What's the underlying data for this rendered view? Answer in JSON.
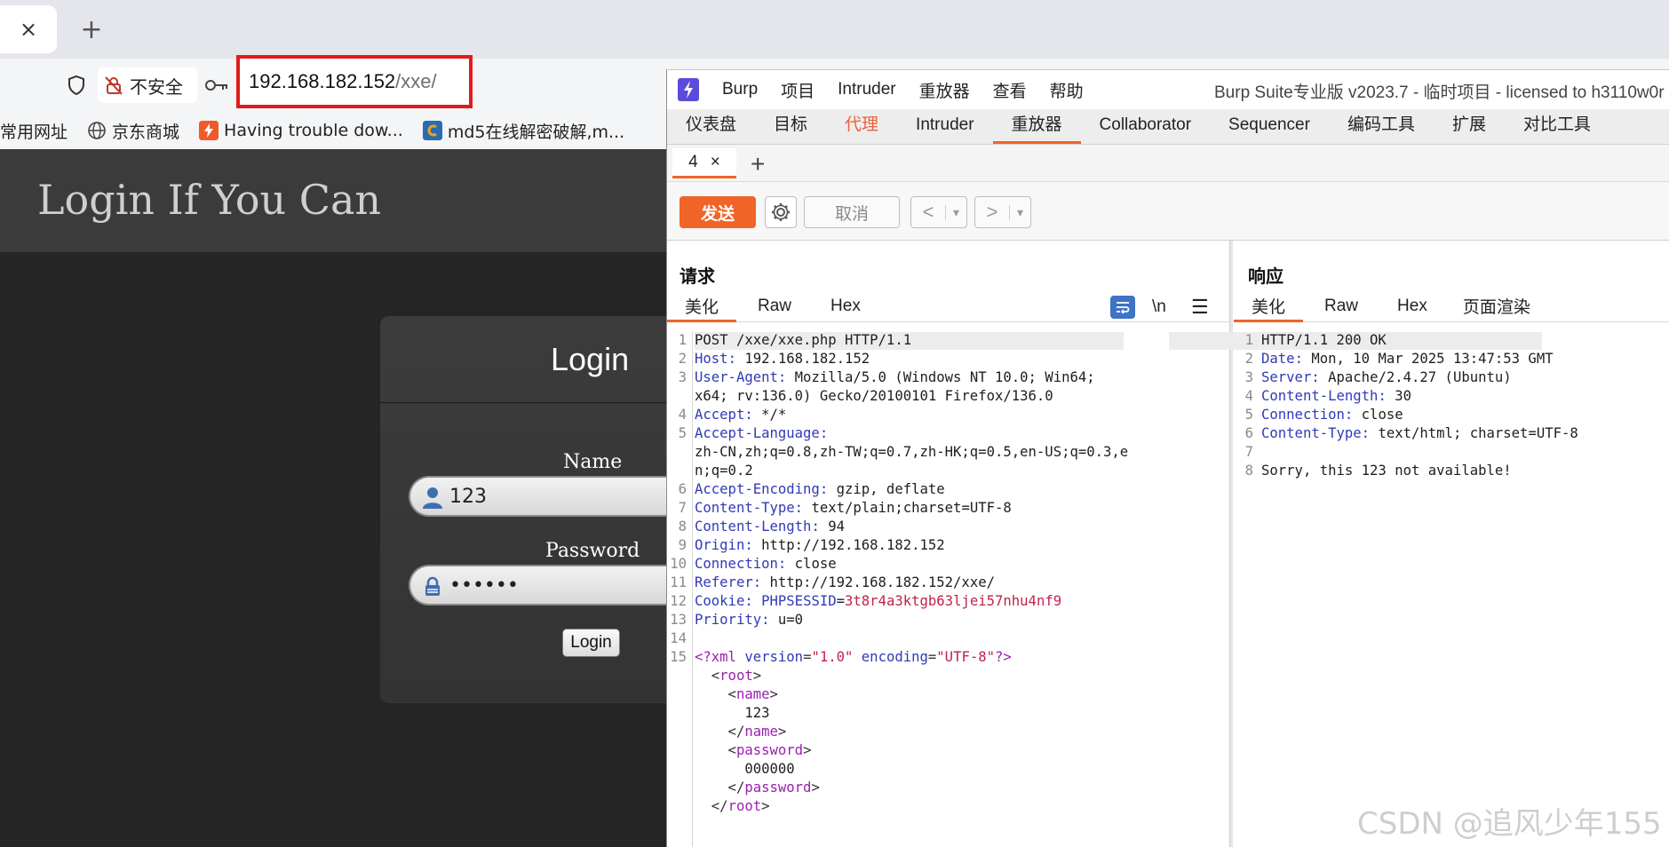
{
  "browser": {
    "tab_close": "×",
    "new_tab": "+",
    "security_label": "不安全",
    "url_host": "192.168.182.152",
    "url_path": "/xxe/",
    "bookmarks": [
      {
        "label": "常用网址",
        "icon": "none"
      },
      {
        "label": "京东商城",
        "icon": "globe-icon"
      },
      {
        "label": "Having trouble dow...",
        "icon": "bolt-icon",
        "color": "#f05a28"
      },
      {
        "label": "md5在线解密破解,m...",
        "icon": "c-icon",
        "color": "#2b6cb0"
      }
    ]
  },
  "page": {
    "title": "Login If You Can",
    "login_heading": "Login",
    "name_label": "Name",
    "name_value": "123",
    "password_label": "Password",
    "password_value": "••••••",
    "login_button": "Login"
  },
  "burp": {
    "menu": [
      "Burp",
      "项目",
      "Intruder",
      "重放器",
      "查看",
      "帮助"
    ],
    "window_title": "Burp Suite专业版  v2023.7 - 临时项目 - licensed to h3110w0r",
    "tabs": [
      "仪表盘",
      "目标",
      "代理",
      "Intruder",
      "重放器",
      "Collaborator",
      "Sequencer",
      "编码工具",
      "扩展",
      "对比工具"
    ],
    "active_tab": "重放器",
    "subtab_label": "4",
    "subtab_close": "×",
    "subtab_add": "+",
    "send": "发送",
    "cancel": "取消",
    "back": "<",
    "forward": ">",
    "dropdown": "▾",
    "accent": "#f06428",
    "request": {
      "title": "请求",
      "tabs": [
        "美化",
        "Raw",
        "Hex"
      ],
      "tool_newline": "\\n",
      "tool_menu": "☰",
      "lines": [
        {
          "n": "1",
          "k": "",
          "v": "POST /xxe/xxe.php HTTP/1.1"
        },
        {
          "n": "2",
          "k": "Host",
          "v": " 192.168.182.152"
        },
        {
          "n": "3",
          "k": "User-Agent",
          "v": " Mozilla/5.0 (Windows NT 10.0; Win64;"
        },
        {
          "n": "",
          "k": "",
          "v": "x64; rv:136.0) Gecko/20100101 Firefox/136.0"
        },
        {
          "n": "4",
          "k": "Accept",
          "v": " */*"
        },
        {
          "n": "5",
          "k": "Accept-Language",
          "v": ""
        },
        {
          "n": "",
          "k": "",
          "v": "zh-CN,zh;q=0.8,zh-TW;q=0.7,zh-HK;q=0.5,en-US;q=0.3,e"
        },
        {
          "n": "",
          "k": "",
          "v": "n;q=0.2"
        },
        {
          "n": "6",
          "k": "Accept-Encoding",
          "v": " gzip, deflate"
        },
        {
          "n": "7",
          "k": "Content-Type",
          "v": " text/plain;charset=UTF-8"
        },
        {
          "n": "8",
          "k": "Content-Length",
          "v": " 94"
        },
        {
          "n": "9",
          "k": "Origin",
          "v": " http://192.168.182.152"
        },
        {
          "n": "10",
          "k": "Connection",
          "v": " close"
        },
        {
          "n": "11",
          "k": "Referer",
          "v": " http://192.168.182.152/xxe/"
        },
        {
          "n": "12",
          "k": "Cookie",
          "v": " ",
          "ck": "PHPSESSID",
          "cv": "3t8r4a3ktgb63ljei57nhu4nf9"
        },
        {
          "n": "13",
          "k": "Priority",
          "v": " u=0"
        },
        {
          "n": "14",
          "k": "",
          "v": ""
        }
      ],
      "xml_decl_line": "15",
      "xml_decl": {
        "open": "<?xml ",
        "a1": "version",
        "v1": "\"1.0\"",
        "a2": "encoding",
        "v2": "\"UTF-8\"",
        "close": "?>"
      },
      "xml": [
        {
          "pre": "  <",
          "tag": "root",
          "post": ">"
        },
        {
          "pre": "    <",
          "tag": "name",
          "post": ">"
        },
        {
          "pre": "      ",
          "text": "123"
        },
        {
          "pre": "    </",
          "tag": "name",
          "post": ">"
        },
        {
          "pre": "    <",
          "tag": "password",
          "post": ">"
        },
        {
          "pre": "      ",
          "text": "000000"
        },
        {
          "pre": "    </",
          "tag": "password",
          "post": ">"
        },
        {
          "pre": "  </",
          "tag": "root",
          "post": ">"
        }
      ]
    },
    "response": {
      "title": "响应",
      "tabs": [
        "美化",
        "Raw",
        "Hex",
        "页面渲染"
      ],
      "lines": [
        {
          "n": "1",
          "k": "",
          "v": "HTTP/1.1 200 OK"
        },
        {
          "n": "2",
          "k": "Date",
          "v": " Mon, 10 Mar 2025 13:47:53 GMT"
        },
        {
          "n": "3",
          "k": "Server",
          "v": " Apache/2.4.27 (Ubuntu)"
        },
        {
          "n": "4",
          "k": "Content-Length",
          "v": " 30"
        },
        {
          "n": "5",
          "k": "Connection",
          "v": " close"
        },
        {
          "n": "6",
          "k": "Content-Type",
          "v": " text/html; charset=UTF-8"
        },
        {
          "n": "7",
          "k": "",
          "v": ""
        },
        {
          "n": "8",
          "k": "",
          "v": "Sorry, this 123 not available!"
        }
      ]
    }
  },
  "watermark": "CSDN @追风少年155"
}
